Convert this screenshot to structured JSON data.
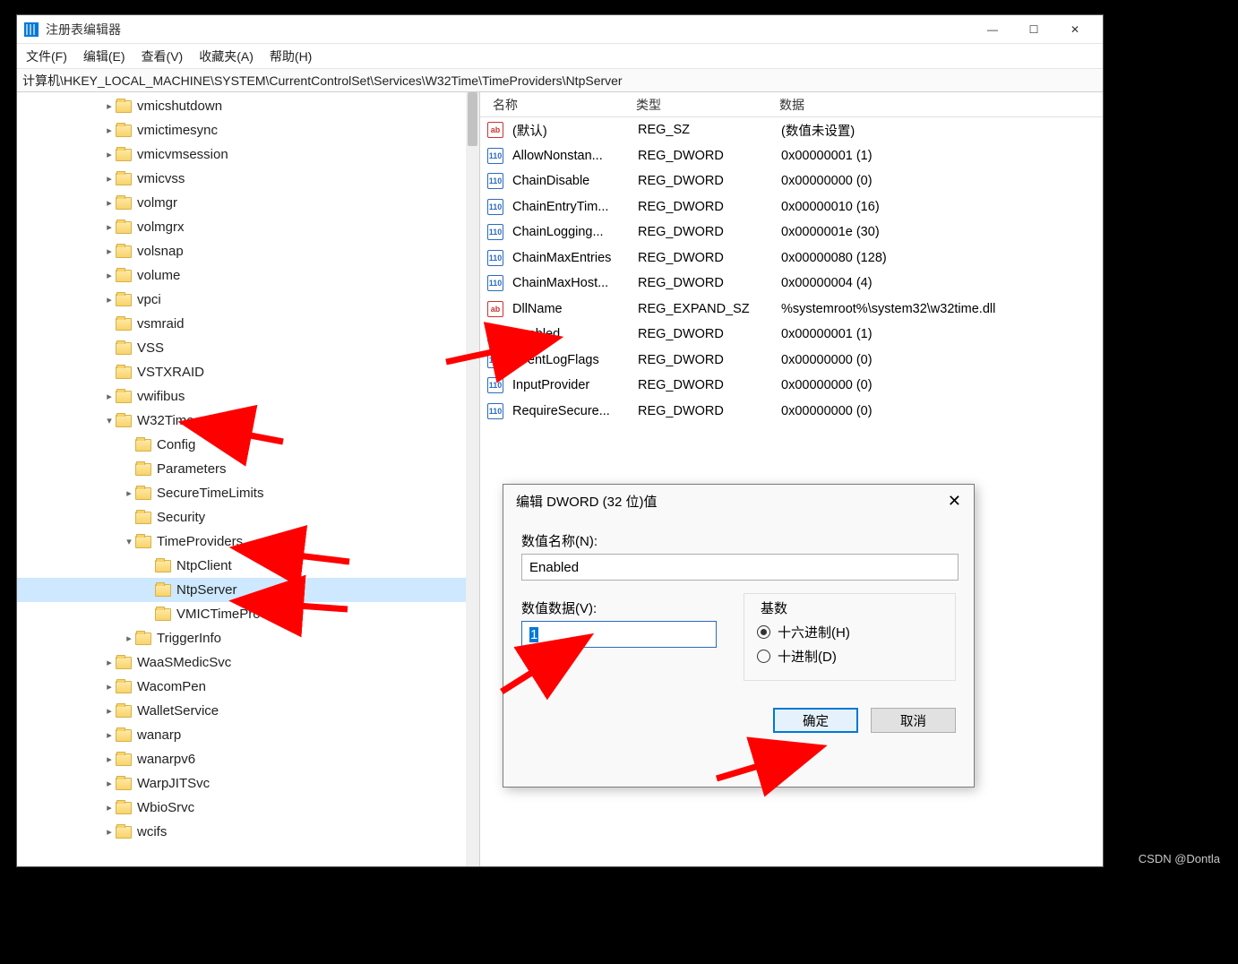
{
  "window": {
    "title": "注册表编辑器",
    "minimize": "—",
    "maximize": "☐",
    "close": "✕"
  },
  "menu": {
    "file": "文件(F)",
    "edit": "编辑(E)",
    "view": "查看(V)",
    "fav": "收藏夹(A)",
    "help": "帮助(H)"
  },
  "address": "计算机\\HKEY_LOCAL_MACHINE\\SYSTEM\\CurrentControlSet\\Services\\W32Time\\TimeProviders\\NtpServer",
  "tree": [
    {
      "indent": 3,
      "exp": "▸",
      "label": "vmicshutdown"
    },
    {
      "indent": 3,
      "exp": "▸",
      "label": "vmictimesync"
    },
    {
      "indent": 3,
      "exp": "▸",
      "label": "vmicvmsession"
    },
    {
      "indent": 3,
      "exp": "▸",
      "label": "vmicvss"
    },
    {
      "indent": 3,
      "exp": "▸",
      "label": "volmgr"
    },
    {
      "indent": 3,
      "exp": "▸",
      "label": "volmgrx"
    },
    {
      "indent": 3,
      "exp": "▸",
      "label": "volsnap"
    },
    {
      "indent": 3,
      "exp": "▸",
      "label": "volume"
    },
    {
      "indent": 3,
      "exp": "▸",
      "label": "vpci"
    },
    {
      "indent": 3,
      "exp": "",
      "label": "vsmraid"
    },
    {
      "indent": 3,
      "exp": "",
      "label": "VSS"
    },
    {
      "indent": 3,
      "exp": "",
      "label": "VSTXRAID"
    },
    {
      "indent": 3,
      "exp": "▸",
      "label": "vwifibus"
    },
    {
      "indent": 3,
      "exp": "▾",
      "label": "W32Time"
    },
    {
      "indent": 4,
      "exp": "",
      "label": "Config"
    },
    {
      "indent": 4,
      "exp": "",
      "label": "Parameters"
    },
    {
      "indent": 4,
      "exp": "▸",
      "label": "SecureTimeLimits"
    },
    {
      "indent": 4,
      "exp": "",
      "label": "Security"
    },
    {
      "indent": 4,
      "exp": "▾",
      "label": "TimeProviders"
    },
    {
      "indent": 5,
      "exp": "",
      "label": "NtpClient"
    },
    {
      "indent": 5,
      "exp": "",
      "label": "NtpServer",
      "selected": true
    },
    {
      "indent": 5,
      "exp": "",
      "label": "VMICTimeProvider"
    },
    {
      "indent": 4,
      "exp": "▸",
      "label": "TriggerInfo"
    },
    {
      "indent": 3,
      "exp": "▸",
      "label": "WaaSMedicSvc"
    },
    {
      "indent": 3,
      "exp": "▸",
      "label": "WacomPen"
    },
    {
      "indent": 3,
      "exp": "▸",
      "label": "WalletService"
    },
    {
      "indent": 3,
      "exp": "▸",
      "label": "wanarp"
    },
    {
      "indent": 3,
      "exp": "▸",
      "label": "wanarpv6"
    },
    {
      "indent": 3,
      "exp": "▸",
      "label": "WarpJITSvc"
    },
    {
      "indent": 3,
      "exp": "▸",
      "label": "WbioSrvc"
    },
    {
      "indent": 3,
      "exp": "▸",
      "label": "wcifs"
    }
  ],
  "list": {
    "headers": {
      "name": "名称",
      "type": "类型",
      "data": "数据"
    },
    "rows": [
      {
        "icon": "sz",
        "name": "(默认)",
        "type": "REG_SZ",
        "data": "(数值未设置)"
      },
      {
        "icon": "dw",
        "name": "AllowNonstan...",
        "type": "REG_DWORD",
        "data": "0x00000001 (1)"
      },
      {
        "icon": "dw",
        "name": "ChainDisable",
        "type": "REG_DWORD",
        "data": "0x00000000 (0)"
      },
      {
        "icon": "dw",
        "name": "ChainEntryTim...",
        "type": "REG_DWORD",
        "data": "0x00000010 (16)"
      },
      {
        "icon": "dw",
        "name": "ChainLogging...",
        "type": "REG_DWORD",
        "data": "0x0000001e (30)"
      },
      {
        "icon": "dw",
        "name": "ChainMaxEntries",
        "type": "REG_DWORD",
        "data": "0x00000080 (128)"
      },
      {
        "icon": "dw",
        "name": "ChainMaxHost...",
        "type": "REG_DWORD",
        "data": "0x00000004 (4)"
      },
      {
        "icon": "sz",
        "name": "DllName",
        "type": "REG_EXPAND_SZ",
        "data": "%systemroot%\\system32\\w32time.dll"
      },
      {
        "icon": "dw",
        "name": "Enabled",
        "type": "REG_DWORD",
        "data": "0x00000001 (1)"
      },
      {
        "icon": "dw",
        "name": "EventLogFlags",
        "type": "REG_DWORD",
        "data": "0x00000000 (0)"
      },
      {
        "icon": "dw",
        "name": "InputProvider",
        "type": "REG_DWORD",
        "data": "0x00000000 (0)"
      },
      {
        "icon": "dw",
        "name": "RequireSecure...",
        "type": "REG_DWORD",
        "data": "0x00000000 (0)"
      }
    ]
  },
  "dialog": {
    "title": "编辑 DWORD (32 位)值",
    "name_label": "数值名称(N):",
    "name_value": "Enabled",
    "data_label": "数值数据(V):",
    "data_value": "1",
    "base_label": "基数",
    "hex_label": "十六进制(H)",
    "dec_label": "十进制(D)",
    "ok": "确定",
    "cancel": "取消",
    "close": "✕"
  },
  "watermark": "CSDN @Dontla"
}
